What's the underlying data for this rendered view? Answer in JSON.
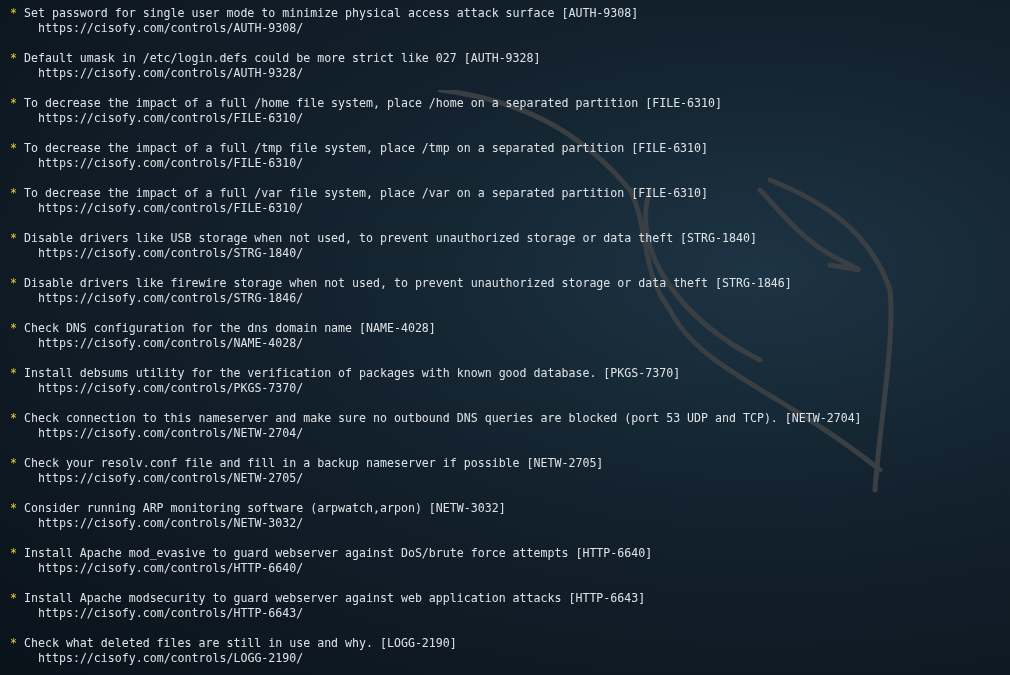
{
  "suggestions": [
    {
      "bullet": "*",
      "text": "Set password for single user mode to minimize physical access attack surface [AUTH-9308]",
      "url": "https://cisofy.com/controls/AUTH-9308/"
    },
    {
      "bullet": "*",
      "text": "Default umask in /etc/login.defs could be more strict like 027 [AUTH-9328]",
      "url": "https://cisofy.com/controls/AUTH-9328/"
    },
    {
      "bullet": "*",
      "text": "To decrease the impact of a full /home file system, place /home on a separated partition [FILE-6310]",
      "url": "https://cisofy.com/controls/FILE-6310/"
    },
    {
      "bullet": "*",
      "text": "To decrease the impact of a full /tmp file system, place /tmp on a separated partition [FILE-6310]",
      "url": "https://cisofy.com/controls/FILE-6310/"
    },
    {
      "bullet": "*",
      "text": "To decrease the impact of a full /var file system, place /var on a separated partition [FILE-6310]",
      "url": "https://cisofy.com/controls/FILE-6310/"
    },
    {
      "bullet": "*",
      "text": "Disable drivers like USB storage when not used, to prevent unauthorized storage or data theft [STRG-1840]",
      "url": "https://cisofy.com/controls/STRG-1840/"
    },
    {
      "bullet": "*",
      "text": "Disable drivers like firewire storage when not used, to prevent unauthorized storage or data theft [STRG-1846]",
      "url": "https://cisofy.com/controls/STRG-1846/"
    },
    {
      "bullet": "*",
      "text": "Check DNS configuration for the dns domain name [NAME-4028]",
      "url": "https://cisofy.com/controls/NAME-4028/"
    },
    {
      "bullet": "*",
      "text": "Install debsums utility for the verification of packages with known good database. [PKGS-7370]",
      "url": "https://cisofy.com/controls/PKGS-7370/"
    },
    {
      "bullet": "*",
      "text": "Check connection to this nameserver and make sure no outbound DNS queries are blocked (port 53 UDP and TCP). [NETW-2704]",
      "url": "https://cisofy.com/controls/NETW-2704/"
    },
    {
      "bullet": "*",
      "text": "Check your resolv.conf file and fill in a backup nameserver if possible [NETW-2705]",
      "url": "https://cisofy.com/controls/NETW-2705/"
    },
    {
      "bullet": "*",
      "text": "Consider running ARP monitoring software (arpwatch,arpon) [NETW-3032]",
      "url": "https://cisofy.com/controls/NETW-3032/"
    },
    {
      "bullet": "*",
      "text": "Install Apache mod_evasive to guard webserver against DoS/brute force attempts [HTTP-6640]",
      "url": "https://cisofy.com/controls/HTTP-6640/"
    },
    {
      "bullet": "*",
      "text": "Install Apache modsecurity to guard webserver against web application attacks [HTTP-6643]",
      "url": "https://cisofy.com/controls/HTTP-6643/"
    },
    {
      "bullet": "*",
      "text": "Check what deleted files are still in use and why. [LOGG-2190]",
      "url": "https://cisofy.com/controls/LOGG-2190/"
    }
  ]
}
